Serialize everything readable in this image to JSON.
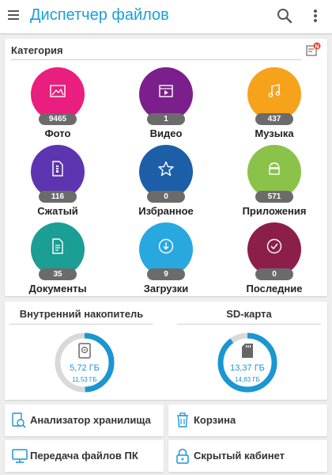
{
  "appbar": {
    "title": "Диспетчер файлов",
    "menu_icon": "hamburger-icon",
    "search_icon": "search-icon",
    "more_icon": "more-vert-icon"
  },
  "category": {
    "header": "Категория",
    "badge_letter": "N",
    "tiles": [
      {
        "label": "Фото",
        "count": "9465",
        "color": "#e91e7e",
        "icon": "image-icon"
      },
      {
        "label": "Видео",
        "count": "1",
        "color": "#7b1f8c",
        "icon": "video-icon"
      },
      {
        "label": "Музыка",
        "count": "437",
        "color": "#f7a21b",
        "icon": "music-note-icon"
      },
      {
        "label": "Сжатый",
        "count": "116",
        "color": "#5e35b1",
        "icon": "zip-icon"
      },
      {
        "label": "Избранное",
        "count": "0",
        "color": "#1c5fa8",
        "icon": "star-icon"
      },
      {
        "label": "Приложения",
        "count": "571",
        "color": "#8bc34a",
        "icon": "android-icon"
      },
      {
        "label": "Документы",
        "count": "35",
        "color": "#1b9e94",
        "icon": "document-icon"
      },
      {
        "label": "Загрузки",
        "count": "9",
        "color": "#29a8e0",
        "icon": "download-icon"
      },
      {
        "label": "Последние",
        "count": "0",
        "color": "#8c1f4a",
        "icon": "recent-check-icon"
      }
    ]
  },
  "storage": {
    "internal": {
      "title": "Внутренний накопитель",
      "used": "5,72 ГБ",
      "total": "11,53 ГБ",
      "used_fraction": 0.496
    },
    "sd": {
      "title": "SD-карта",
      "used": "13,37 ГБ",
      "total": "14,83 ГБ",
      "used_fraction": 0.9
    }
  },
  "actions": {
    "analyzer": "Анализатор хранилища",
    "trash": "Корзина",
    "pc_transfer": "Передача файлов ПК",
    "hidden": "Скрытый кабинет"
  },
  "colors": {
    "accent": "#1aa0d8",
    "ring_track": "#d9d9d9"
  }
}
